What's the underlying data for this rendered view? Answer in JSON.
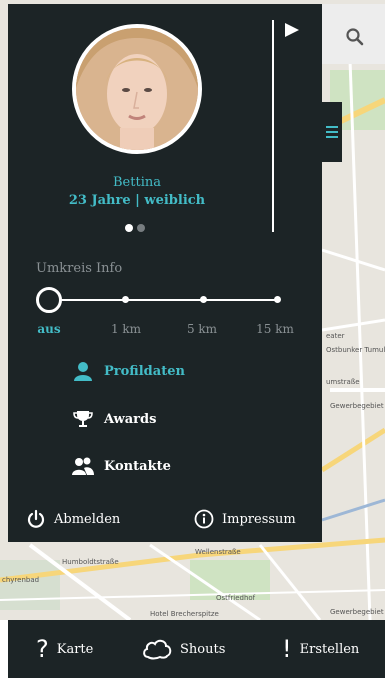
{
  "profile": {
    "name": "Bettina",
    "info": "23 Jahre | weiblich"
  },
  "radius": {
    "title": "Umkreis Info",
    "options": [
      "aus",
      "1 km",
      "5 km",
      "15 km"
    ],
    "selected": "aus"
  },
  "menu": {
    "profile": "Profildaten",
    "awards": "Awards",
    "contacts": "Kontakte"
  },
  "actions": {
    "logout": "Abmelden",
    "imprint": "Impressum"
  },
  "nav": {
    "map": "Karte",
    "shouts": "Shouts",
    "create": "Erstellen"
  },
  "map_labels": {
    "street1": "Wellenstraße",
    "street2": "Humboldtstraße",
    "area1": "chyrenbad",
    "area2": "Ostfriedhof",
    "area3": "Hotel Brecherspitze",
    "area4": "Gewerbegebiet",
    "area5": "Gewerbegebiet Grillpa",
    "area6": "Ostbunker Tumulk",
    "area7": "umstraße",
    "area8": "eater"
  },
  "colors": {
    "panel": "#1c2426",
    "accent": "#43bcc7",
    "muted": "#8a9194"
  }
}
